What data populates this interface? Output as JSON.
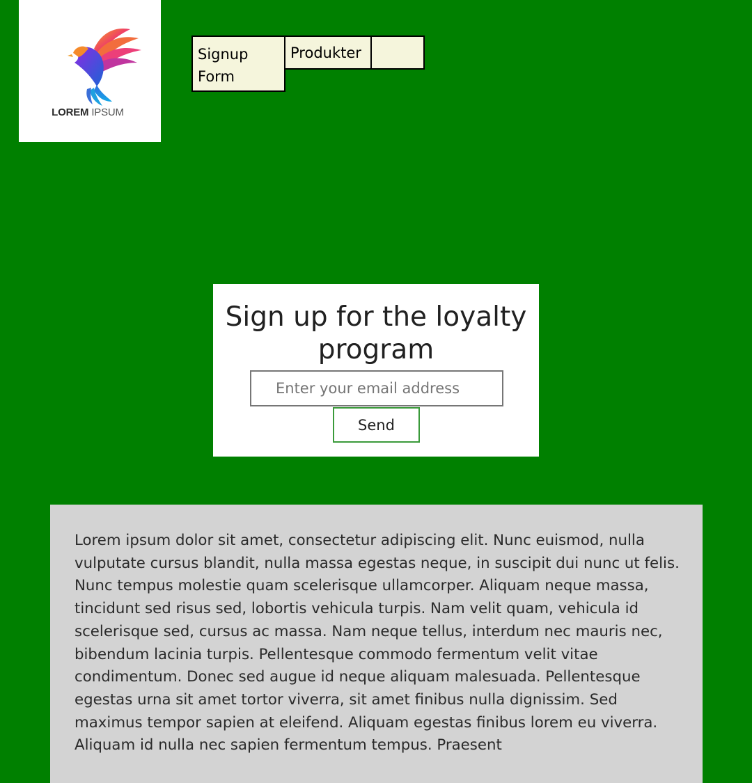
{
  "logo": {
    "word_bold": "LOREM",
    "word_light": "IPSUM",
    "icon": "bird-logo-icon"
  },
  "nav": {
    "items": [
      {
        "label": "Signup Form"
      },
      {
        "label": "Produkter"
      },
      {
        "label": ""
      }
    ]
  },
  "signup": {
    "title": "Sign up for the loyalty program",
    "email_placeholder": "Enter your email address",
    "email_value": "",
    "send_label": "Send"
  },
  "content": {
    "text": "Lorem ipsum dolor sit amet, consectetur adipiscing elit. Nunc euismod, nulla vulputate cursus blandit, nulla massa egestas neque, in suscipit dui nunc ut felis. Nunc tempus molestie quam scelerisque ullamcorper. Aliquam neque massa, tincidunt sed risus sed, lobortis vehicula turpis. Nam velit quam, vehicula id scelerisque sed, cursus ac massa. Nam neque tellus, interdum nec mauris nec, bibendum lacinia turpis. Pellentesque commodo fermentum velit vitae condimentum. Donec sed augue id neque aliquam malesuada. Pellentesque egestas urna sit amet tortor viverra, sit amet finibus nulla dignissim. Sed maximus tempor sapien at eleifend. Aliquam egestas finibus lorem eu viverra. Aliquam id nulla nec sapien fermentum tempus. Praesent"
  },
  "colors": {
    "page_background": "#008000",
    "nav_background": "#f5f5dc",
    "content_background": "#d3d3d3",
    "send_border": "#3a9a3a"
  }
}
